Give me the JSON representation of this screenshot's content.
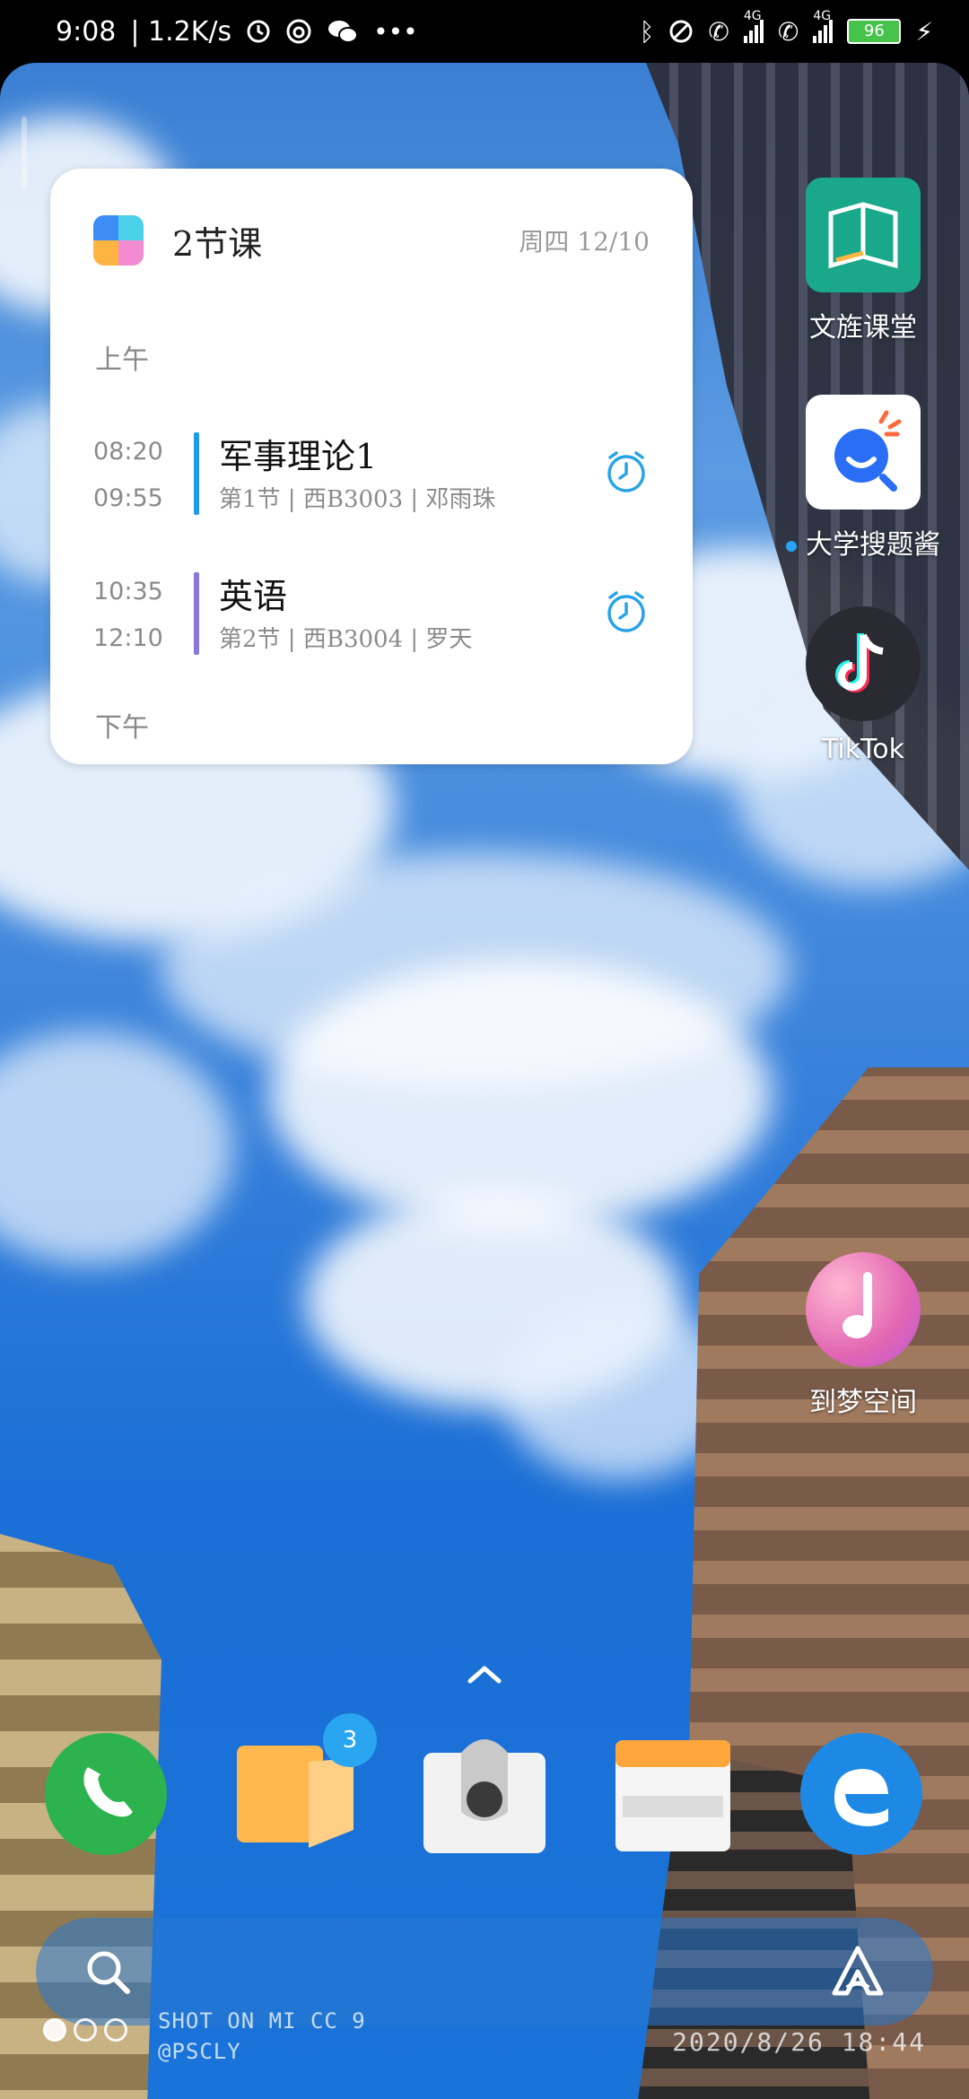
{
  "status_bar": {
    "time": "9:08",
    "network_speed": "| 1.2K/s",
    "left_icons": [
      "clock-icon",
      "netease-music-icon",
      "wechat-icon",
      "more-dots-icon"
    ],
    "right_icons": [
      "bluetooth-icon",
      "mute-icon",
      "wifi-call-icon",
      "signal-4g-icon",
      "wifi-call-icon",
      "signal-4g-icon"
    ],
    "network_type_1": "4G",
    "network_type_2": "4G",
    "battery_level": "96",
    "charging": true
  },
  "widget": {
    "title": "2节课",
    "date": "周四 12/10",
    "section_morning": "上午",
    "section_afternoon": "下午",
    "courses": [
      {
        "start": "08:20",
        "end": "09:55",
        "name": "军事理论1",
        "detail": "第1节 | 西B3003 | 邓雨珠",
        "color": "#1f9be8"
      },
      {
        "start": "10:35",
        "end": "12:10",
        "name": "英语",
        "detail": "第2节 | 西B3004 | 罗天",
        "color": "#8a77d9"
      }
    ],
    "logo_colors": [
      "#3d8df5",
      "#4ad0e8",
      "#ffb340",
      "#f28bd2"
    ]
  },
  "apps": [
    {
      "label": "文旌课堂",
      "icon": "book-icon",
      "color": "#1aa88a",
      "has_new_dot": false
    },
    {
      "label": "大学搜题酱",
      "icon": "search-chat-icon",
      "color": "#ffffff",
      "has_new_dot": true
    },
    {
      "label": "TikTok",
      "icon": "tiktok-icon",
      "color": "#2a2a33",
      "has_new_dot": false
    },
    {
      "label": "到梦空间",
      "icon": "music-note-icon",
      "color": "#f07ab5",
      "has_new_dot": false
    }
  ],
  "dock": [
    {
      "name": "phone",
      "icon": "phone-icon",
      "color": "#2db34e"
    },
    {
      "name": "notes",
      "icon": "notes-icon",
      "color": "#ffb84d",
      "badge": "3"
    },
    {
      "name": "camera",
      "icon": "camera-icon",
      "color": "#eeeeee"
    },
    {
      "name": "wallet",
      "icon": "wallet-icon",
      "color": "#f5f5f5"
    },
    {
      "name": "edge",
      "icon": "edge-browser-icon",
      "color": "#1e88e5"
    }
  ],
  "bottom": {
    "watermark_line1": "SHOT ON MI CC 9",
    "watermark_line2": "@PSCLY",
    "timestamp": "2020/8/26 18:44",
    "page_count": 3,
    "active_page": 0
  }
}
